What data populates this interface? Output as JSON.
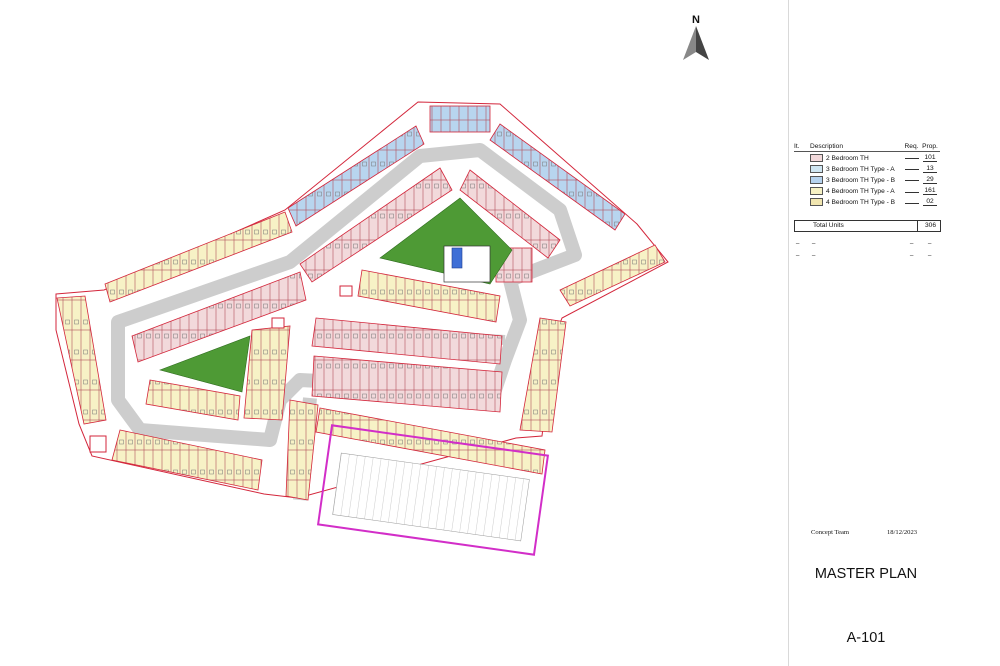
{
  "drawing": {
    "north_label": "N",
    "title": "MASTER PLAN",
    "sheet_number": "A-101",
    "team": "Concept Team",
    "date": "18/12/2023"
  },
  "legend": {
    "headers": {
      "item": "It.",
      "description": "Description",
      "required": "Req.",
      "proposed": "Prop."
    },
    "rows": [
      {
        "description": "2 Bedroom TH",
        "required": "",
        "proposed": "101",
        "color": "#f2d9db"
      },
      {
        "description": "3 Bedroom TH Type - A",
        "required": "",
        "proposed": "13",
        "color": "#cfe6f2"
      },
      {
        "description": "3 Bedroom TH Type - B",
        "required": "",
        "proposed": "29",
        "color": "#b5d2ee"
      },
      {
        "description": "4 Bedroom TH Type - A",
        "required": "",
        "proposed": "161",
        "color": "#f6f1c4"
      },
      {
        "description": "4 Bedroom TH Type - B",
        "required": "",
        "proposed": "02",
        "color": "#f1e6b0"
      }
    ],
    "total_label": "Total Units",
    "total_value": "306"
  },
  "colors": {
    "road": "#cdcdcd",
    "park": "#4e9a35",
    "plot_outline": "#d3263b",
    "boundary_magenta": "#d22ec8",
    "pool": "#3f6fd6"
  },
  "features": [
    "road-network",
    "parks",
    "swimming-pool",
    "parking-block",
    "townhouse-rows"
  ]
}
